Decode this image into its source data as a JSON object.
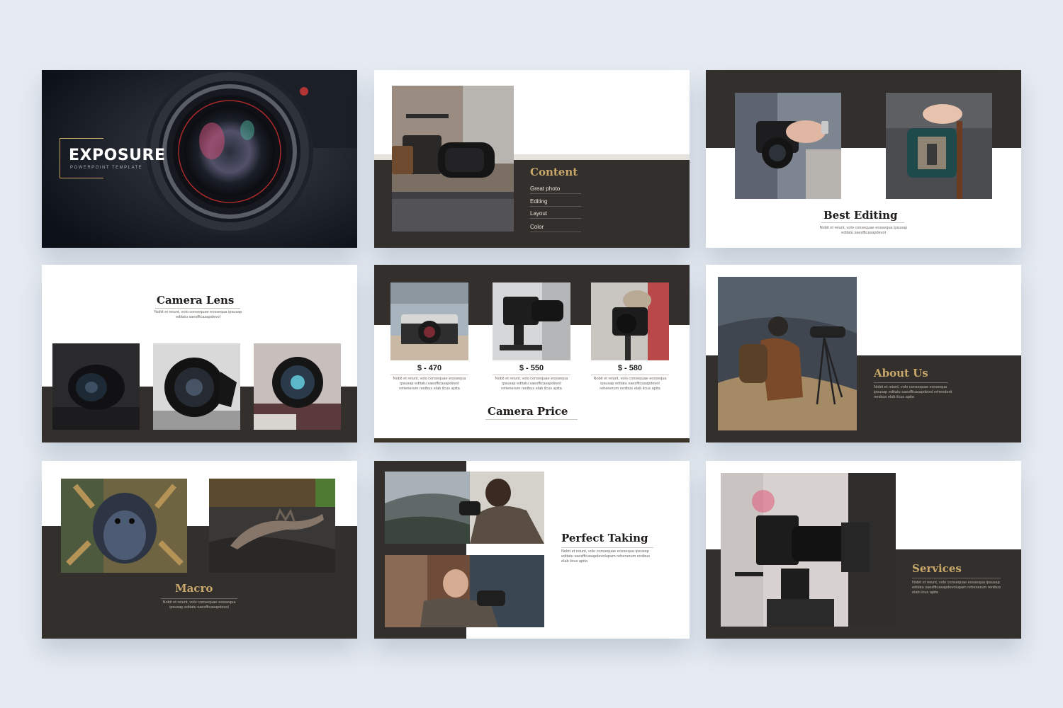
{
  "slides": {
    "cover": {
      "title": "EXPOSURE",
      "subtitle": "POWERPOINT TEMPLATE"
    },
    "content": {
      "title": "Content",
      "items": [
        "Great photo",
        "Editing",
        "Layout",
        "Color"
      ]
    },
    "best_editing": {
      "title": "Best Editing",
      "body": "Nobit et reiunt, volo consequae eossequa ipsusap editatu saesfficasapdevol"
    },
    "camera_lens": {
      "title": "Camera Lens",
      "body": "Nobit et reiunt, volo consequae eossequa ipsusap editatu saesfficasapdevol"
    },
    "camera_price": {
      "title": "Camera Price",
      "prices": [
        "$ - 470",
        "$ - 550",
        "$ - 580"
      ],
      "body": "Nobit et reiunt, volo consequae eossequa ipsusap editatu saesfficasapdevol rehenerum renibus elab ilcus apita"
    },
    "about_us": {
      "title": "About Us",
      "body": "Nobit et reiunt, volo consequae eossequa ipsusap editatu saesfficasapdevol rehenderit renibus elab ilcus apita"
    },
    "macro": {
      "title": "Macro",
      "body": "Nobit et reiunt, volo consequae eossequa ipsusap editatu saesfficasapdevol"
    },
    "perfect_taking": {
      "title": "Perfect Taking",
      "body": "Nobit et reiunt, volo consequae eossequa ipsusap editatu saesfficasapdevolupam rehenerum renibus elab ilcus apita"
    },
    "services": {
      "title": "Services",
      "body": "Nobit et reiunt, volo consequae eossequa ipsusap editatu saesfficasapdevolupam rehenerum renibus elab ilcus apita"
    }
  },
  "colors": {
    "background": "#e6ebf2",
    "dark_panel": "#322f2d",
    "accent_gold": "#c9a86a",
    "title_dark": "#1f1c1a"
  },
  "icons": [
    "camera-lens-photo",
    "camera-photo",
    "spider-photo",
    "lizard-photo",
    "photographer-photo"
  ]
}
